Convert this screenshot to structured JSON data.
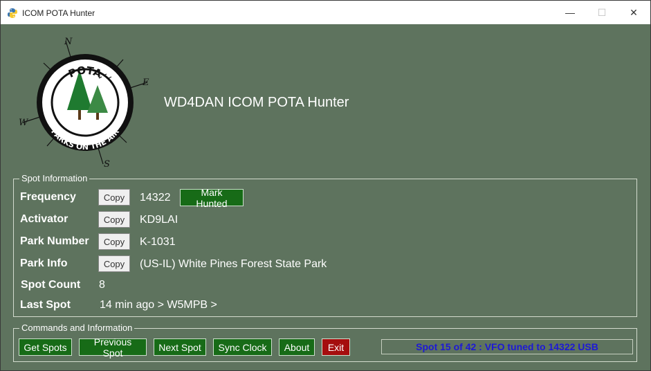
{
  "window": {
    "title": "ICOM POTA Hunter",
    "minimize": "—",
    "maximize": "☐",
    "close": "✕"
  },
  "logo": {
    "text_top": "POTA",
    "text_bottom": "PARKS ON THE AIR",
    "compass_n": "N",
    "compass_e": "E",
    "compass_s": "S",
    "compass_w": "W"
  },
  "heading": "WD4DAN ICOM POTA Hunter",
  "spot_info": {
    "legend": "Spot Information",
    "frequency": {
      "label": "Frequency",
      "copy": "Copy",
      "value": "14322",
      "mark_hunted": "Mark Hunted"
    },
    "activator": {
      "label": "Activator",
      "copy": "Copy",
      "value": "KD9LAI"
    },
    "park_number": {
      "label": "Park Number",
      "copy": "Copy",
      "value": "K-1031"
    },
    "park_info": {
      "label": "Park Info",
      "copy": "Copy",
      "value": "(US-IL) White Pines Forest State Park"
    },
    "spot_count": {
      "label": "Spot Count",
      "value": "8"
    },
    "last_spot": {
      "label": "Last Spot",
      "value": "14 min ago > W5MPB >"
    }
  },
  "commands": {
    "legend": "Commands and Information",
    "get_spots": "Get Spots",
    "previous_spot": "Previous Spot",
    "next_spot": "Next Spot",
    "sync_clock": "Sync Clock",
    "about": "About",
    "exit": "Exit",
    "status": "Spot 15 of 42 : VFO tuned to 14322 USB"
  },
  "colors": {
    "background": "#5e735e",
    "button_green": "#176b17",
    "button_red": "#a50e0e",
    "status_text": "#1d19d6"
  }
}
